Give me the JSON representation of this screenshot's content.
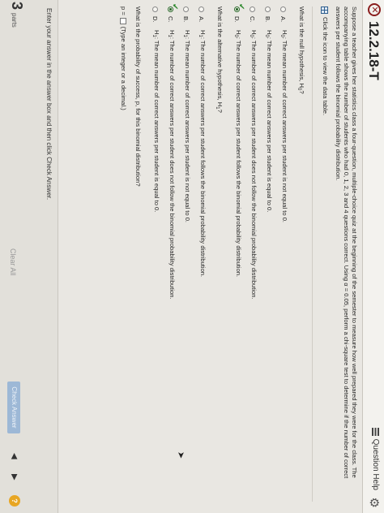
{
  "header": {
    "title": "12.2.18-T",
    "help_label": "Question Help"
  },
  "problem": {
    "text": "Suppose a teacher gives her statistics class a four-question, multiple-choice quiz at the beginning of the semester to measure how well prepared they were for the class. The accompanying table shows the number of students who had 0, 1, 2, 3 and 4 questions correct. Using α = 0.05, perform a chi-square test to determine if the number of correct answers per student follows the binomial probability distribution.",
    "data_link": "Click the icon to view the data table."
  },
  "q_null": {
    "prompt_before": "What is the null hypothesis, H",
    "prompt_sub": "0",
    "prompt_after": "?",
    "options": [
      {
        "letter": "A.",
        "h": "H",
        "sub": "0",
        "text": ": The mean number of correct answers per student is not equal to 0."
      },
      {
        "letter": "B.",
        "h": "H",
        "sub": "0",
        "text": ": The mean number of correct answers per student is equal to 0."
      },
      {
        "letter": "C.",
        "h": "H",
        "sub": "0",
        "text": ": The number of correct answers per student does not follow the binomial probability distribution."
      },
      {
        "letter": "D.",
        "h": "H",
        "sub": "0",
        "text": ": The number of correct answers per student follows the binomial probability distribution."
      }
    ],
    "selected": "D"
  },
  "q_alt": {
    "prompt_before": "What is the alternative hypothesis, H",
    "prompt_sub": "1",
    "prompt_after": "?",
    "options": [
      {
        "letter": "A.",
        "h": "H",
        "sub": "1",
        "text": ": The number of correct answers per student follows the binomial probability distribution."
      },
      {
        "letter": "B.",
        "h": "H",
        "sub": "1",
        "text": ": The mean number of correct answers per student is not equal to 0."
      },
      {
        "letter": "C.",
        "h": "H",
        "sub": "1",
        "text": ": The number of correct answers per student does not follow the binomial probability distribution."
      },
      {
        "letter": "D.",
        "h": "H",
        "sub": "1",
        "text": ": The mean number of correct answers per student is equal to 0."
      }
    ],
    "selected": "C"
  },
  "q_prob": {
    "prompt": "What is the probability of success, p, for this binomial distribution?",
    "label": "p =",
    "hint": "(Type an integer or a decimal.)"
  },
  "footer": {
    "instruction": "Enter your answer in the answer box and then click Check Answer.",
    "parts_count": "3",
    "parts_label": "parts",
    "clear_all": "Clear All",
    "check_answer": "Check Answer",
    "help_symbol": "?"
  },
  "colors": {
    "accent_button": "#9db8d6",
    "correct_check": "#2f8a2f",
    "incorrect_status": "#8a1d1d",
    "help_bubble": "#e8a623"
  }
}
